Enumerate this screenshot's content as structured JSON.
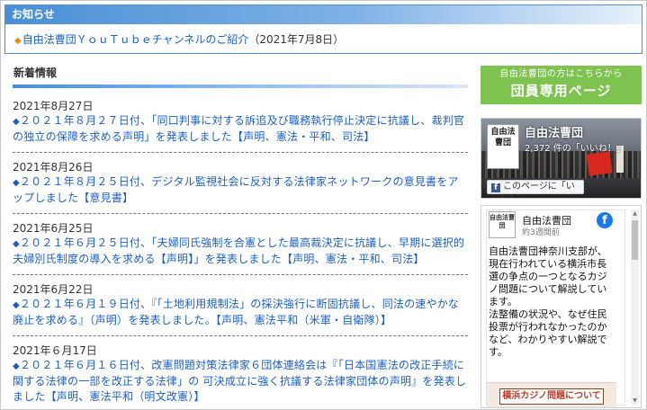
{
  "notice": {
    "heading": "お知らせ",
    "items": [
      {
        "marker": "◆",
        "link_text": "自由法曹団ＹｏｕＴｕｂｅチャンネルのご紹介",
        "date": "（2021年7月8日）"
      }
    ]
  },
  "news": {
    "heading": "新着情報",
    "items": [
      {
        "date": "2021年8月27日",
        "marker": "◆",
        "text": "２０２１年８月２７日付、「同口判事に対する訴追及び職務執行停止決定に抗議し、裁判官の独立の保障を求める声明」を発表しました【声明、憲法・平和、司法】"
      },
      {
        "date": "2021年8月26日",
        "marker": "◆",
        "text": "２０２１年８月２５日付、デジタル監視社会に反対する法律家ネットワークの意見書をアップしました【意見書】"
      },
      {
        "date": "2021年6月25日",
        "marker": "◆",
        "text": "２０２１年６月２５日付、「夫婦同氏強制を合憲とした最高裁決定に抗議し、早期に選択的夫婦別氏制度の導入を求める【声明】」を発表しました【声明、憲法・平和、司法】"
      },
      {
        "date": "2021年6月22日",
        "marker": "◆",
        "text": "２０２１年６月１９日付、『「土地利用規制法」の採決強行に断固抗議し、同法の速やかな廃止を求める』（声明）を発表しました。【声明、憲法平和（米軍・自衛隊）】"
      },
      {
        "date": "2021年６月17日",
        "marker": "◆",
        "text": "２０２１年６月１６日付、改憲問題対策法律家６団体連絡会は『「日本国憲法の改正手続に関する法律の一部を改正する法律」の 可決成立に強く抗議する法律家団体の声明』を発表しました【声明、憲法平和（明文改憲）】"
      }
    ]
  },
  "sidebar": {
    "member_banner": {
      "small": "自由法曹団の方はこちらから",
      "big": "団員専用ページ"
    },
    "fb_cover": {
      "logo_text": "自由法曹団",
      "page_name": "自由法曹団",
      "likes": "2,372 件の「いいね！」",
      "like_button": "このページに「いいね！」"
    },
    "fb_post": {
      "avatar_text": "自由法曹団",
      "author": "自由法曹団",
      "time": "約3週間前",
      "body": "自由法曹団神奈川支部が、現在行われている横浜市長選の争点の一つとなるカジノ問題について解説しています。\n法整備の状況や、なぜ住民投票が行われなかったのかなど、わかりやすい解説です。",
      "image_label": "横浜カジノ問題について"
    }
  },
  "colors": {
    "accent_blue": "#4a8fd6",
    "link_blue": "#1a5fc9",
    "notice_marker": "#f08a00",
    "member_green": "#7ec24f",
    "facebook_blue": "#1877f2"
  },
  "icons": {
    "facebook_square": "facebook-f-icon",
    "facebook_round": "facebook-round-icon"
  }
}
